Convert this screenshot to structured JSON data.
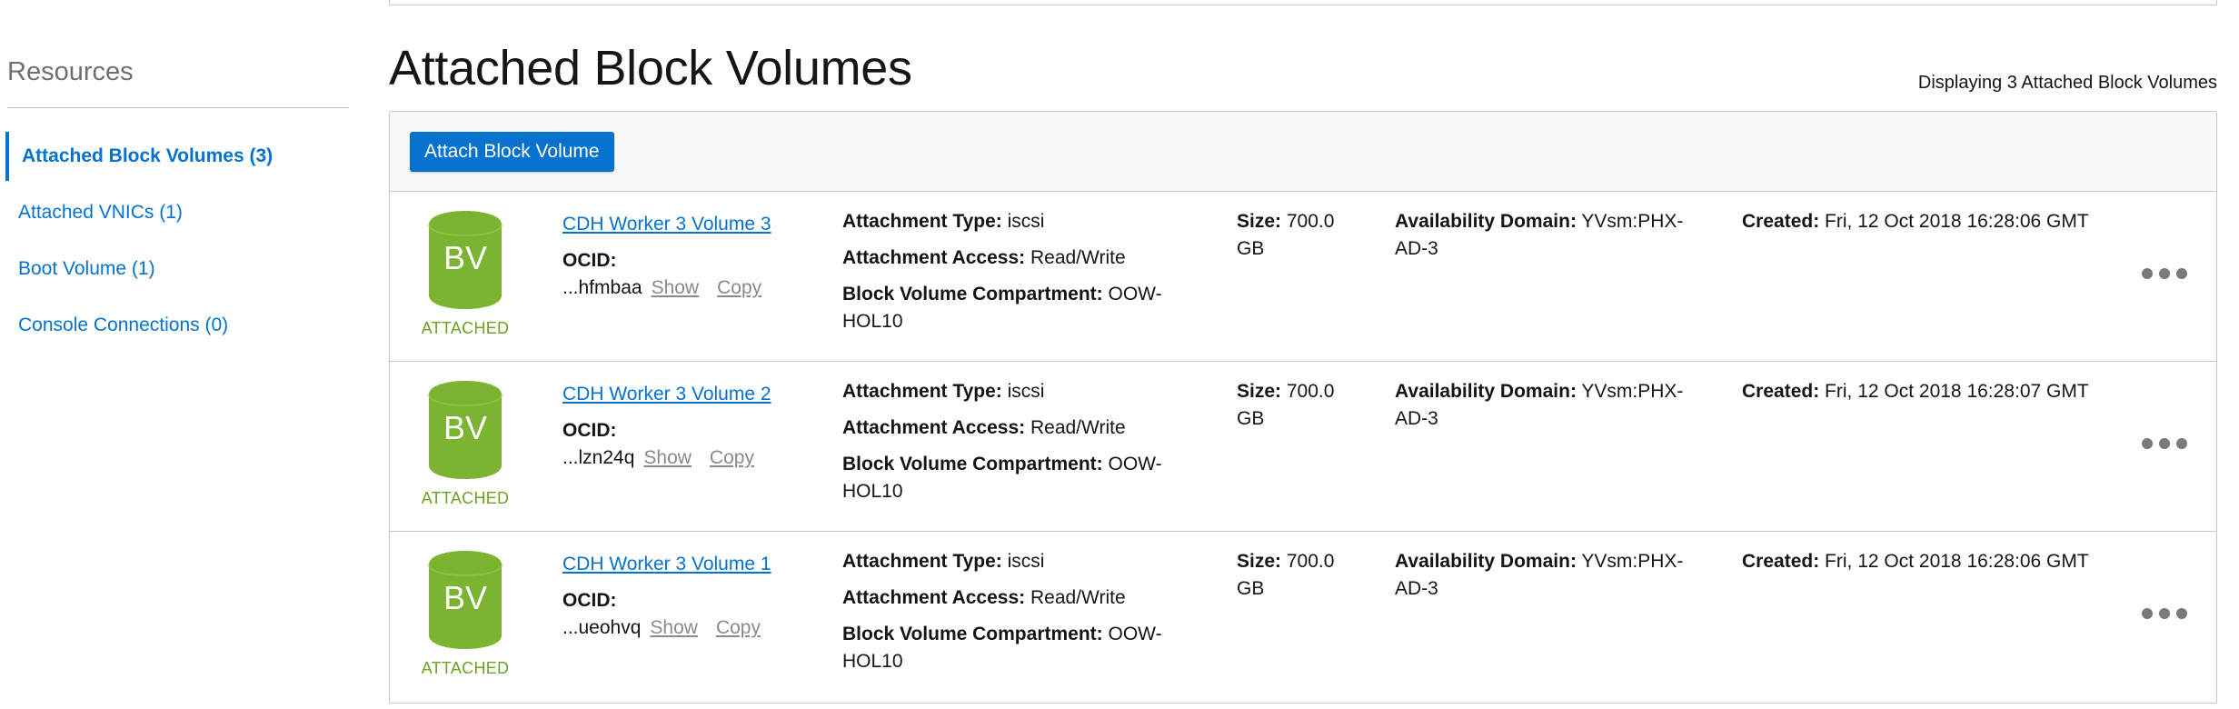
{
  "sidebar": {
    "title": "Resources",
    "items": [
      {
        "label": "Attached Block Volumes (3)",
        "active": true
      },
      {
        "label": "Attached VNICs (1)",
        "active": false
      },
      {
        "label": "Boot Volume (1)",
        "active": false
      },
      {
        "label": "Console Connections (0)",
        "active": false
      }
    ]
  },
  "main": {
    "title": "Attached Block Volumes",
    "display_count": "Displaying 3 Attached Block Volumes",
    "attach_button": "Attach Block Volume"
  },
  "colors": {
    "accent": "#0572ce",
    "bv_green": "#7ab430",
    "status_green": "#6fa123"
  },
  "labels": {
    "icon_text": "BV",
    "ocid": "OCID:",
    "show": "Show",
    "copy": "Copy",
    "attachment_type": "Attachment Type:",
    "attachment_access": "Attachment Access:",
    "compartment": "Block Volume Compartment:",
    "size": "Size:",
    "availability_domain": "Availability Domain:",
    "created": "Created:"
  },
  "volumes": [
    {
      "name": "CDH Worker 3 Volume 3",
      "status": "ATTACHED",
      "ocid_short": "...hfmbaa",
      "attachment_type": "iscsi",
      "attachment_access": "Read/Write",
      "compartment": "OOW-HOL10",
      "size": "700.0 GB",
      "availability_domain": "YVsm:PHX-AD-3",
      "created": "Fri, 12 Oct 2018 16:28:06 GMT"
    },
    {
      "name": "CDH Worker 3 Volume 2",
      "status": "ATTACHED",
      "ocid_short": "...lzn24q",
      "attachment_type": "iscsi",
      "attachment_access": "Read/Write",
      "compartment": "OOW-HOL10",
      "size": "700.0 GB",
      "availability_domain": "YVsm:PHX-AD-3",
      "created": "Fri, 12 Oct 2018 16:28:07 GMT"
    },
    {
      "name": "CDH Worker 3 Volume 1",
      "status": "ATTACHED",
      "ocid_short": "...ueohvq",
      "attachment_type": "iscsi",
      "attachment_access": "Read/Write",
      "compartment": "OOW-HOL10",
      "size": "700.0 GB",
      "availability_domain": "YVsm:PHX-AD-3",
      "created": "Fri, 12 Oct 2018 16:28:06 GMT"
    }
  ]
}
